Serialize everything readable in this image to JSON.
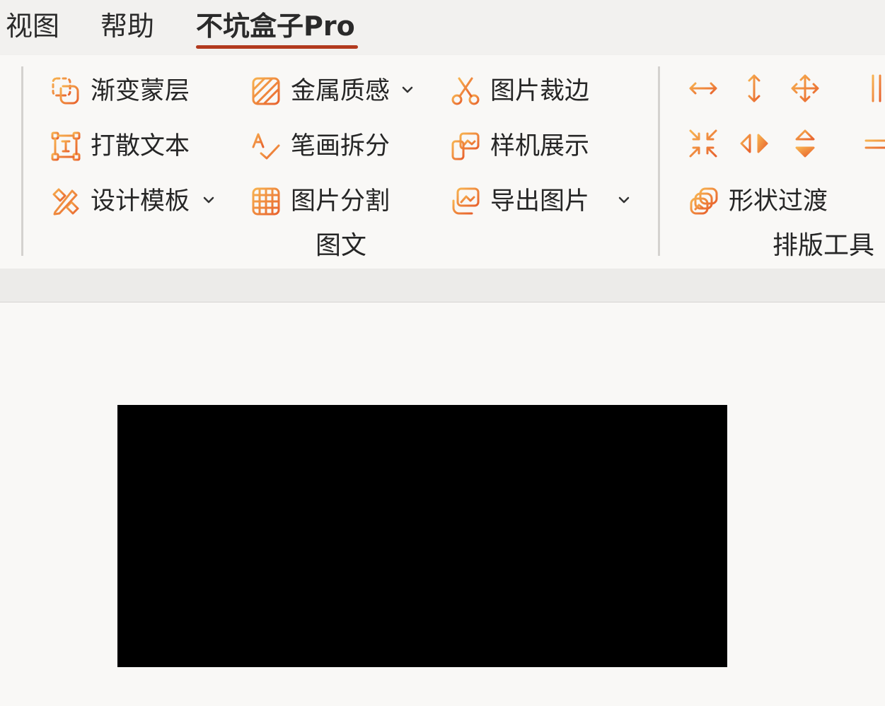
{
  "tabs": [
    {
      "label": "视图"
    },
    {
      "label": "帮助"
    },
    {
      "label": "不坑盒子Pro",
      "active": true
    }
  ],
  "colors": {
    "accent_start": "#f7b250",
    "accent_end": "#e8622d",
    "active_tab_underline": "#b23a1e",
    "slide_fill": "#000000"
  },
  "ribbon": {
    "groups": [
      {
        "label": "图文",
        "buttons": [
          {
            "label": "渐变蒙层",
            "icon": "gradient-mask-icon"
          },
          {
            "label": "金属质感",
            "icon": "metal-texture-icon",
            "dropdown": true
          },
          {
            "label": "图片裁边",
            "icon": "scissors-icon"
          },
          {
            "label": "打散文本",
            "icon": "break-text-icon"
          },
          {
            "label": "笔画拆分",
            "icon": "stroke-split-icon"
          },
          {
            "label": "样机展示",
            "icon": "mockup-icon"
          },
          {
            "label": "设计模板",
            "icon": "design-template-icon",
            "dropdown": true
          },
          {
            "label": "图片分割",
            "icon": "grid-split-icon"
          },
          {
            "label": "导出图片",
            "icon": "export-image-icon",
            "dropdown": true
          }
        ]
      },
      {
        "label": "排版工具",
        "icon_buttons": [
          "horizontal-distribute-icon",
          "vertical-distribute-icon",
          "move-arrows-icon",
          "align-columns-icon",
          "shrink-icon",
          "flip-horizontal-icon",
          "flip-vertical-icon",
          "align-rows-icon"
        ],
        "buttons": [
          {
            "label": "形状过渡",
            "icon": "shape-transition-icon"
          }
        ]
      }
    ]
  }
}
